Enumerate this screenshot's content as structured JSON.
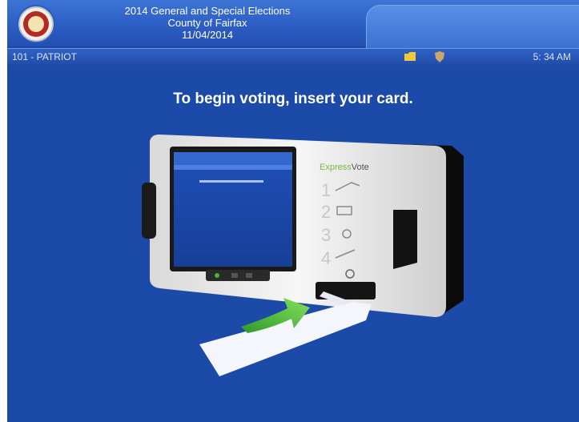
{
  "header": {
    "election_title": "2014 General and Special Elections",
    "county": "County of Fairfax",
    "date": "11/04/2014"
  },
  "status_bar": {
    "precinct": "101 - PATRIOT",
    "time": "5: 34 AM"
  },
  "main": {
    "instruction": "To begin voting, insert your card."
  },
  "device": {
    "brand_prefix": "Express",
    "brand_suffix": "Vote",
    "steps": [
      "1",
      "2",
      "3",
      "4"
    ]
  },
  "colors": {
    "background": "#1b4aa8",
    "header": "#2a5cc2",
    "arrow": "#5cc23a"
  },
  "icons": [
    "county-seal-icon",
    "folder-icon",
    "shield-icon",
    "insert-arrow-icon"
  ]
}
